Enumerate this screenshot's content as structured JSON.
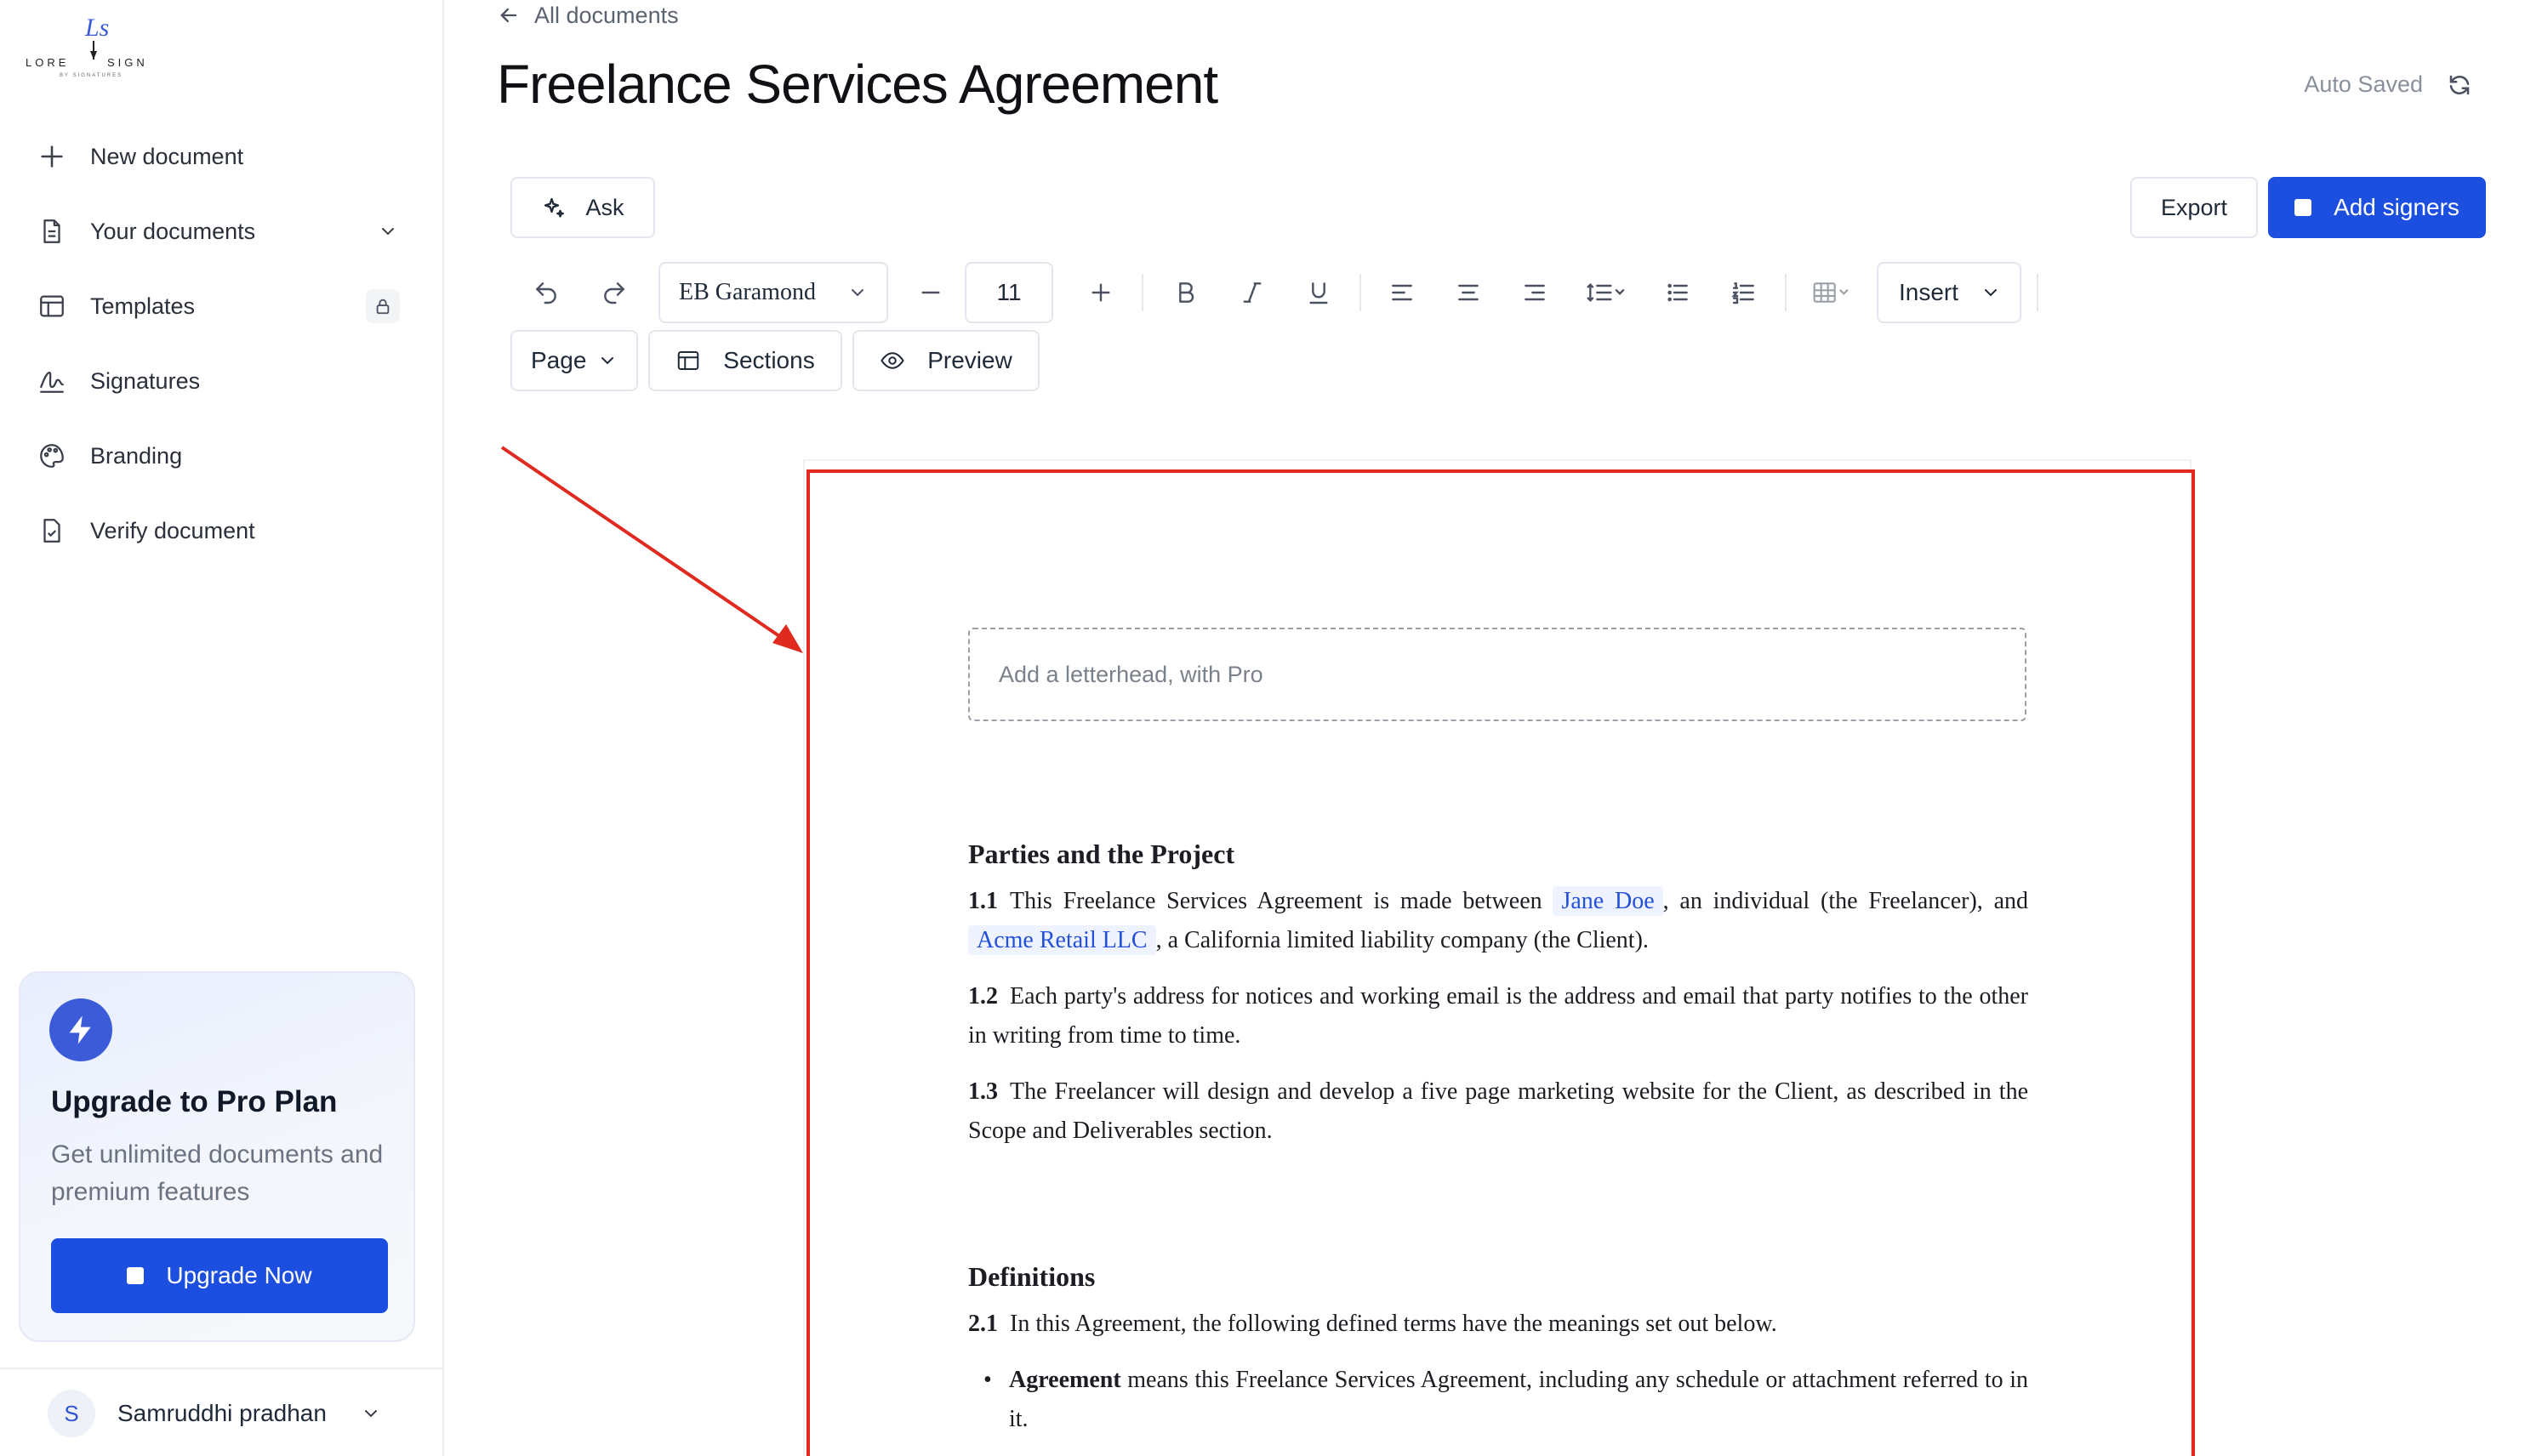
{
  "brand": {
    "name_left": "LORE",
    "name_right": "SIGN",
    "tagline": "BY SIGNATURES",
    "accent": "#1c4fe0"
  },
  "sidebar": {
    "items": [
      {
        "label": "New document",
        "icon": "plus-icon"
      },
      {
        "label": "Your documents",
        "icon": "document-icon",
        "trailing": "chevron-down-icon"
      },
      {
        "label": "Templates",
        "icon": "layout-icon",
        "trailing": "lock-icon"
      },
      {
        "label": "Signatures",
        "icon": "signature-icon"
      },
      {
        "label": "Branding",
        "icon": "palette-icon"
      },
      {
        "label": "Verify document",
        "icon": "verify-document-icon"
      }
    ],
    "upgrade": {
      "title": "Upgrade to Pro Plan",
      "description": "Get unlimited documents and premium features",
      "button": "Upgrade Now"
    },
    "user": {
      "initial": "S",
      "name": "Samruddhi pradhan"
    }
  },
  "header": {
    "back_label": "All documents",
    "title": "Freelance Services Agreement",
    "status": "Auto Saved"
  },
  "actions": {
    "ask": "Ask",
    "export": "Export",
    "add_signers": "Add signers"
  },
  "toolbar": {
    "font": "EB Garamond",
    "font_size": "11",
    "insert": "Insert",
    "page": "Page",
    "sections": "Sections",
    "preview": "Preview"
  },
  "document": {
    "letterhead_placeholder": "Add a letterhead, with Pro",
    "sections": [
      {
        "heading": "Parties and the Project",
        "clauses": [
          {
            "num": "1.1",
            "pre": "This Freelance Services Agreement is made between",
            "party1": "Jane Doe",
            "mid": ", an individual (the Freelancer), and",
            "party2": "Acme Retail LLC",
            "post": ", a California limited liability company (the Client)."
          },
          {
            "num": "1.2",
            "text": "Each party's address for notices and working email is the address and email that party notifies to the other in writing from time to time."
          },
          {
            "num": "1.3",
            "text": "The Freelancer will design and develop a five page marketing website for the Client, as described in the Scope and Deliverables section."
          }
        ]
      },
      {
        "heading": "Definitions",
        "clauses": [
          {
            "num": "2.1",
            "text": "In this Agreement, the following defined terms have the meanings set out below."
          }
        ],
        "bullets": [
          {
            "term": "Agreement",
            "text": "means this Freelance Services Agreement, including any schedule or attachment referred to in it."
          }
        ]
      }
    ]
  }
}
